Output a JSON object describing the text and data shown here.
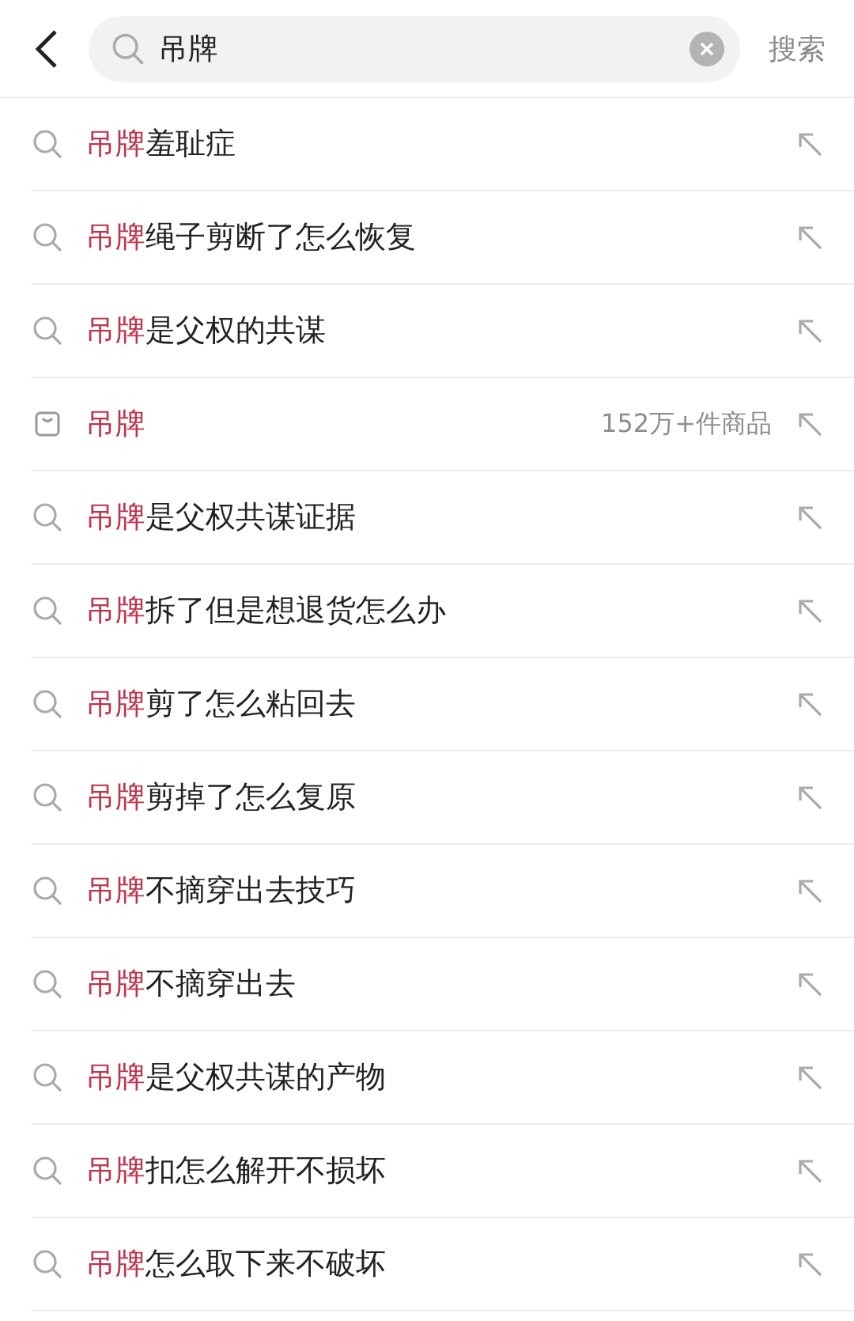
{
  "search": {
    "value": "吊牌",
    "action": "搜索"
  },
  "suggestions": [
    {
      "kind": "query",
      "highlight": "吊牌",
      "rest": "羞耻症"
    },
    {
      "kind": "query",
      "highlight": "吊牌",
      "rest": "绳子剪断了怎么恢复"
    },
    {
      "kind": "query",
      "highlight": "吊牌",
      "rest": "是父权的共谋"
    },
    {
      "kind": "product",
      "highlight": "吊牌",
      "count": "152万+件商品"
    },
    {
      "kind": "query",
      "highlight": "吊牌",
      "rest": "是父权共谋证据"
    },
    {
      "kind": "query",
      "highlight": "吊牌",
      "rest": "拆了但是想退货怎么办"
    },
    {
      "kind": "query",
      "highlight": "吊牌",
      "rest": "剪了怎么粘回去"
    },
    {
      "kind": "query",
      "highlight": "吊牌",
      "rest": "剪掉了怎么复原"
    },
    {
      "kind": "query",
      "highlight": "吊牌",
      "rest": "不摘穿出去技巧"
    },
    {
      "kind": "query",
      "highlight": "吊牌",
      "rest": "不摘穿出去"
    },
    {
      "kind": "query",
      "highlight": "吊牌",
      "rest": "是父权共谋的产物"
    },
    {
      "kind": "query",
      "highlight": "吊牌",
      "rest": "扣怎么解开不损坏"
    },
    {
      "kind": "query",
      "highlight": "吊牌",
      "rest": "怎么取下来不破坏"
    }
  ]
}
